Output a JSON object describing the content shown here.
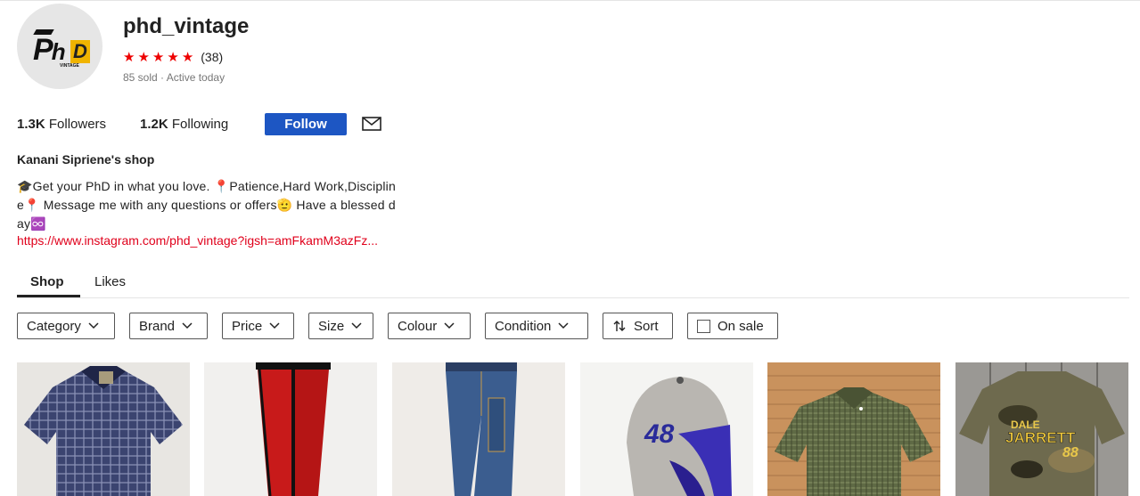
{
  "shop": {
    "username": "phd_vintage",
    "avatar_text": "PhD",
    "avatar_sub": "VINTAGE",
    "rating_count": "(38)",
    "stars": 5,
    "meta": "85 sold · Active today"
  },
  "stats": {
    "followers_count": "1.3K",
    "followers_label": "Followers",
    "following_count": "1.2K",
    "following_label": "Following",
    "follow_button": "Follow"
  },
  "bio": {
    "owner": "Kanani Sipriene's shop",
    "line1": "🎓Get your PhD in what you love. 📍Patience,Hard Work,Disciplin",
    "line2": "e📍 Message me with any questions or offers🫡 Have a blessed d",
    "line3": "ay♾️",
    "link": "https://www.instagram.com/phd_vintage?igsh=amFkamM3azFz..."
  },
  "tabs": {
    "shop": "Shop",
    "likes": "Likes"
  },
  "filters": {
    "category": "Category",
    "brand": "Brand",
    "price": "Price",
    "size": "Size",
    "colour": "Colour",
    "condition": "Condition",
    "sort": "Sort",
    "on_sale": "On sale"
  },
  "products": [
    {
      "name": "product-plaid-polo"
    },
    {
      "name": "product-red-track-pants"
    },
    {
      "name": "product-carpenter-jeans"
    },
    {
      "name": "product-48-racing-cap"
    },
    {
      "name": "product-green-check-shirt"
    },
    {
      "name": "product-dale-jarrett-camo-tee"
    }
  ],
  "colors": {
    "star": "#ee0000",
    "follow_bg": "#1d56c3",
    "link": "#e0001b"
  }
}
